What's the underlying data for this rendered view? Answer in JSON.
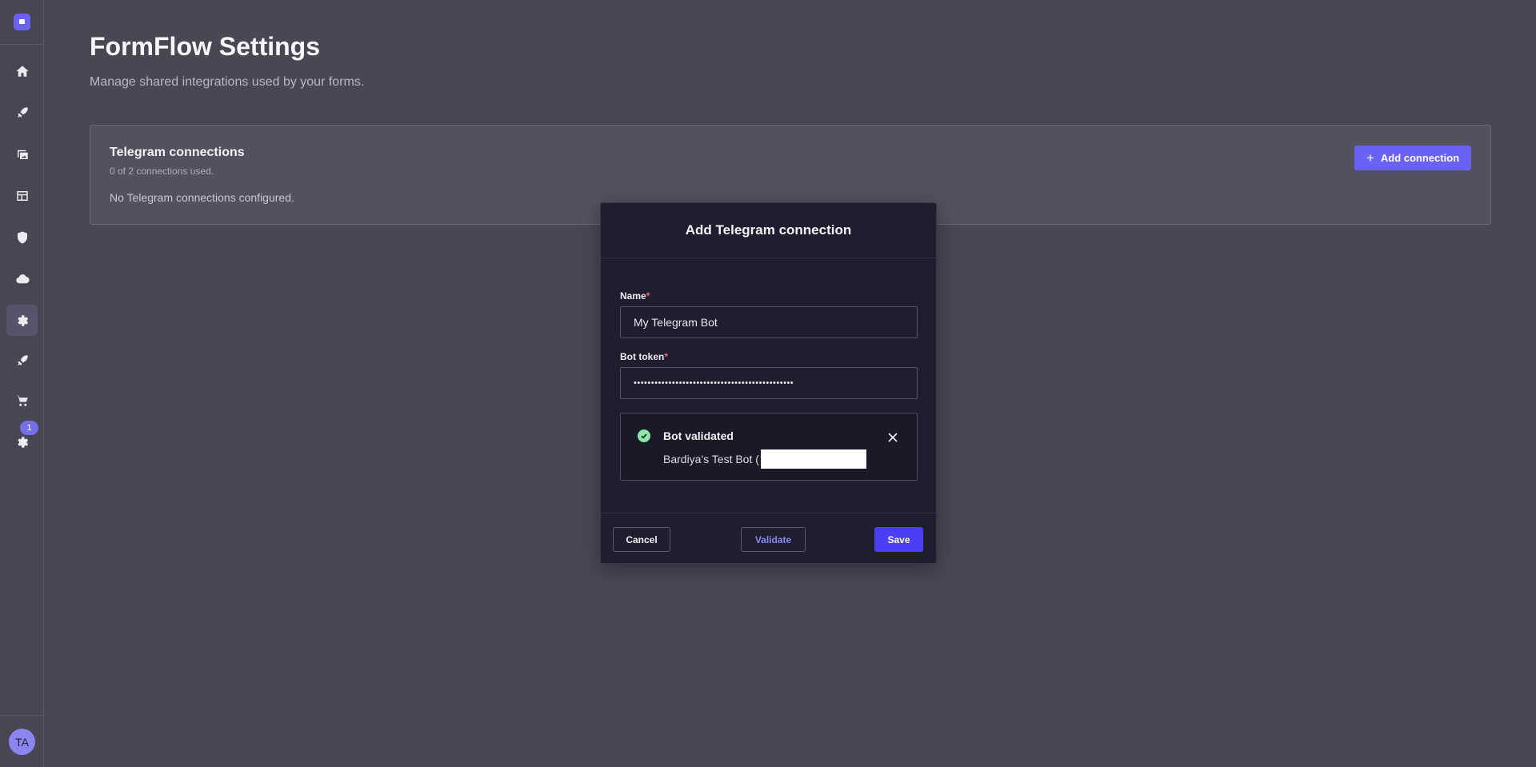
{
  "sidebar": {
    "items": [
      {
        "name": "home-icon"
      },
      {
        "name": "rocket-icon"
      },
      {
        "name": "images-icon"
      },
      {
        "name": "layout-icon"
      },
      {
        "name": "shield-icon"
      },
      {
        "name": "cloud-icon"
      },
      {
        "name": "gear-icon",
        "active": true
      },
      {
        "name": "rocket-icon"
      },
      {
        "name": "cart-icon"
      },
      {
        "name": "gear-icon"
      }
    ],
    "badge": "1",
    "avatar_initials": "TA"
  },
  "page": {
    "title": "FormFlow Settings",
    "subtitle": "Manage shared integrations used by your forms."
  },
  "card": {
    "title": "Telegram connections",
    "usage": "0 of 2 connections used.",
    "empty_message": "No Telegram connections configured.",
    "add_button": "Add connection"
  },
  "modal": {
    "title": "Add Telegram connection",
    "name_label": "Name",
    "name_value": "My Telegram Bot",
    "token_label": "Bot token",
    "token_value": "••••••••••••••••••••••••••••••••••••••••••••••",
    "required_marker": "*",
    "validation": {
      "title": "Bot validated",
      "detail": "Bardiya's Test Bot ("
    },
    "cancel_button": "Cancel",
    "validate_button": "Validate",
    "save_button": "Save"
  },
  "colors": {
    "accent": "#6a62f7",
    "primary": "#4a3ff5",
    "success": "#8fe6a8",
    "required": "#f26b7b"
  }
}
